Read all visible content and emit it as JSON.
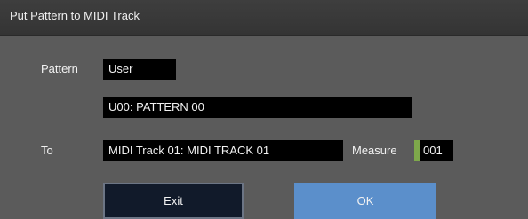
{
  "dialog": {
    "title": "Put Pattern to MIDI Track"
  },
  "pattern": {
    "label": "Pattern",
    "bank": "User",
    "name": "U00: PATTERN 00"
  },
  "destination": {
    "label": "To",
    "track": "MIDI Track 01: MIDI TRACK 01",
    "measure_label": "Measure",
    "measure_value": "001"
  },
  "buttons": {
    "exit": "Exit",
    "ok": "OK"
  },
  "colors": {
    "ok_button": "#5b8fcb",
    "measure_accent": "#7ea84b"
  }
}
